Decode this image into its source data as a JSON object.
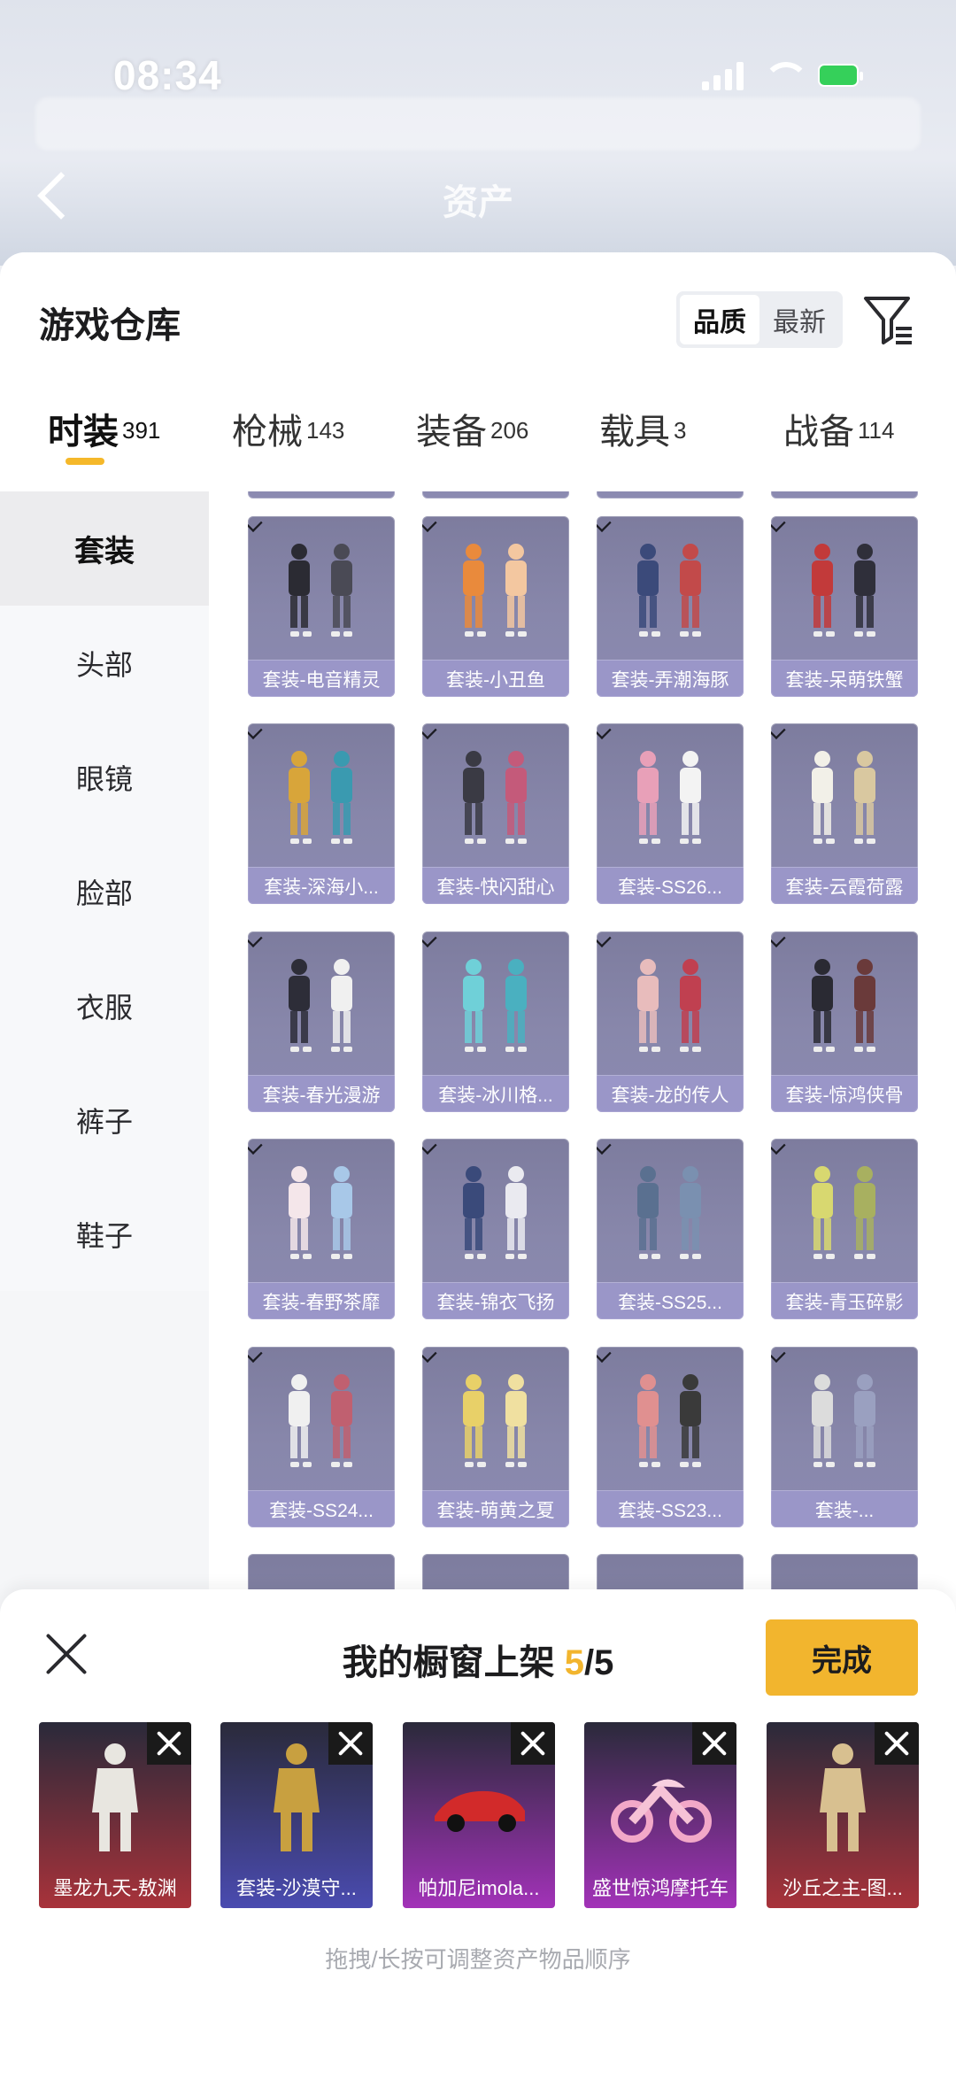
{
  "status_bar": {
    "time": "08:34"
  },
  "background": {
    "title": "资产"
  },
  "sheet": {
    "title": "游戏仓库",
    "sort": {
      "options": [
        "品质",
        "最新"
      ],
      "active": "品质"
    },
    "tabs": [
      {
        "label": "时装",
        "count": "391",
        "active": true
      },
      {
        "label": "枪械",
        "count": "143",
        "active": false
      },
      {
        "label": "装备",
        "count": "206",
        "active": false
      },
      {
        "label": "载具",
        "count": "3",
        "active": false
      },
      {
        "label": "战备",
        "count": "114",
        "active": false
      }
    ],
    "sidebar": [
      "套装",
      "头部",
      "眼镜",
      "脸部",
      "衣服",
      "裤子",
      "鞋子"
    ],
    "items": [
      "套装-电音精灵",
      "套装-小丑鱼",
      "套装-弄潮海豚",
      "套装-呆萌铁蟹",
      "套装-深海小...",
      "套装-快闪甜心",
      "套装-SS26...",
      "套装-云霞荷露",
      "套装-春光漫游",
      "套装-冰川格...",
      "套装-龙的传人",
      "套装-惊鸿侠骨",
      "套装-春野茶靡",
      "套装-锦衣飞扬",
      "套装-SS25...",
      "套装-青玉碎影",
      "套装-SS24...",
      "套装-萌黄之夏",
      "套装-SS23...",
      "套装-..."
    ]
  },
  "showcase": {
    "title_prefix": "我的橱窗上架 ",
    "count_current": "5",
    "count_total": "/5",
    "done_label": "完成",
    "slots": [
      {
        "label": "墨龙九天-敖渊",
        "color": "#a8323a"
      },
      {
        "label": "套装-沙漠守...",
        "color": "#4a4bb0"
      },
      {
        "label": "帕加尼imola...",
        "color": "#a232b8"
      },
      {
        "label": "盛世惊鸿摩托车",
        "color": "#a232b8"
      },
      {
        "label": "沙丘之主-图...",
        "color": "#a8323a"
      }
    ],
    "hint": "拖拽/长按可调整资产物品顺序"
  },
  "colors": {
    "accent": "#f2b52e"
  }
}
